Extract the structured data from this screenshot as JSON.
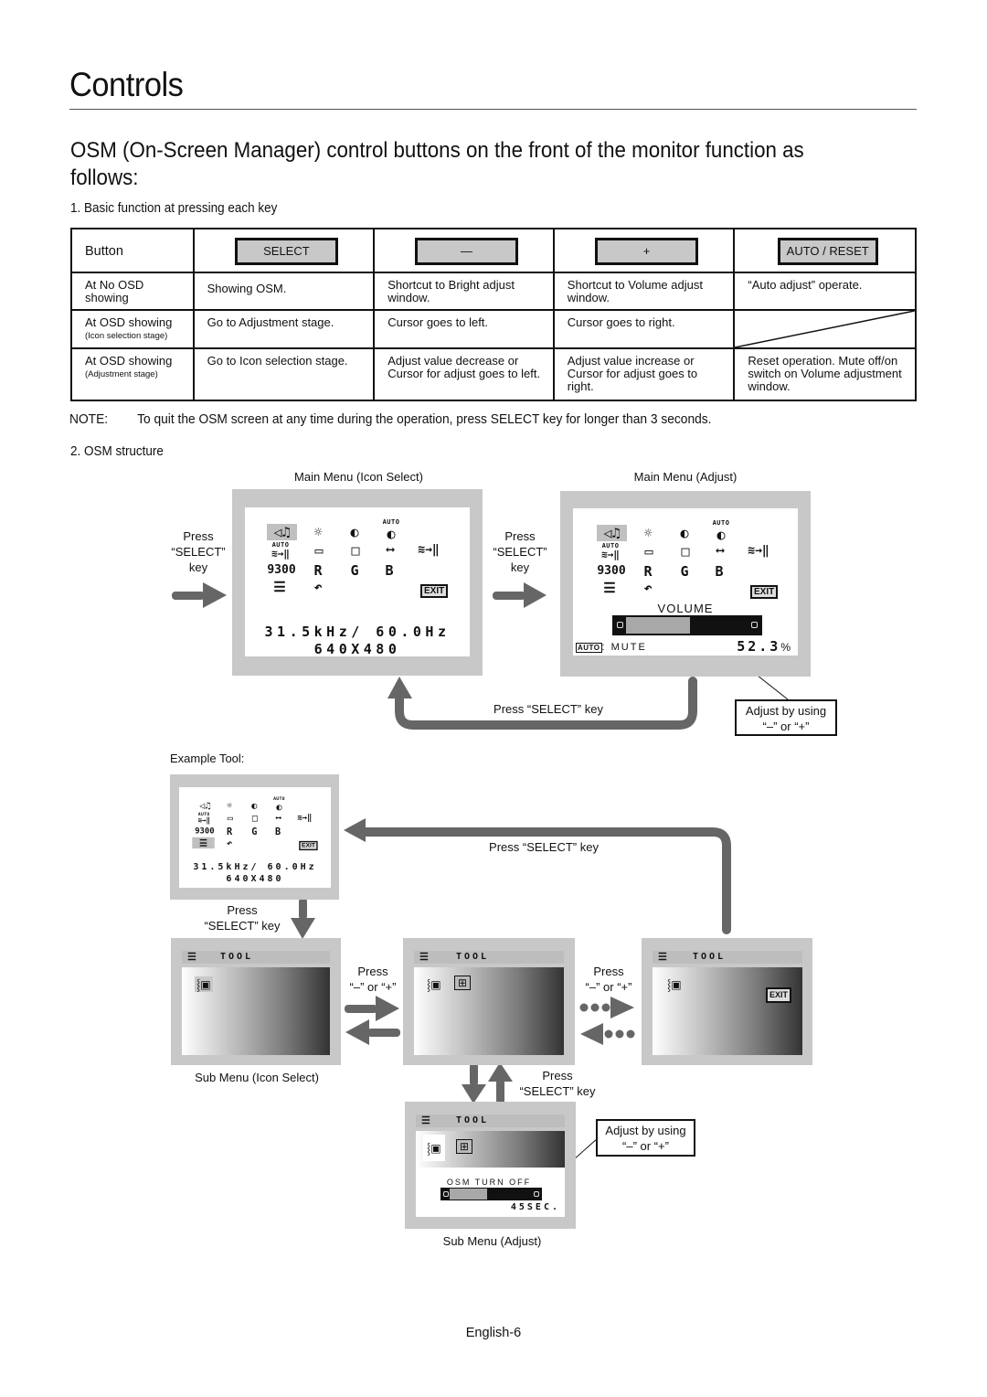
{
  "page": {
    "title": "Controls",
    "intro": "OSM (On-Screen Manager) control buttons on the front of the monitor function as follows:",
    "section1": "1. Basic function at pressing each key",
    "note_label": "NOTE:",
    "note_text": "To quit the OSM screen at any time during the operation, press SELECT key for longer than 3 seconds.",
    "section2": "2. OSM structure",
    "footer": "English-6"
  },
  "table": {
    "header_label": "Button",
    "keys": [
      "SELECT",
      "—",
      "+",
      "AUTO / RESET"
    ],
    "rows": [
      {
        "label": "At No OSD showing",
        "sublabel": "",
        "cells": [
          "Showing OSM.",
          "Shortcut to Bright adjust window.",
          "Shortcut to Volume adjust window.",
          "“Auto adjust” operate."
        ]
      },
      {
        "label": "At OSD showing",
        "sublabel": "(Icon selection stage)",
        "cells": [
          "Go to Adjustment stage.",
          "Cursor goes to left.",
          "Cursor goes to right.",
          ""
        ]
      },
      {
        "label": "At OSD showing",
        "sublabel": "(Adjustment stage)",
        "cells": [
          "Go to Icon selection stage.",
          "Adjust value decrease or Cursor for adjust goes to left.",
          "Adjust value increase or Cursor for adjust goes to right.",
          "Reset operation. Mute off/on switch on Volume adjustment window."
        ]
      }
    ]
  },
  "diagram": {
    "main_icon_select_caption": "Main Menu (Icon Select)",
    "main_adjust_caption": "Main Menu (Adjust)",
    "press_select_key_stacked": [
      "Press",
      "“SELECT”",
      "key"
    ],
    "press_select_key": "Press “SELECT” key",
    "press_select_two_line": [
      "Press",
      "“SELECT” key"
    ],
    "press_minus_plus": [
      "Press",
      "“–” or “+”"
    ],
    "adjust_by_using": [
      "Adjust by using",
      "“–” or “+”"
    ],
    "example_tool": "Example Tool:",
    "sub_icon_select_caption": "Sub Menu (Icon Select)",
    "sub_adjust_caption": "Sub Menu (Adjust)",
    "osm_icons": {
      "auto_tag": "AUTO",
      "row3": [
        "9300",
        "R",
        "G",
        "B"
      ],
      "exit": "EXIT"
    },
    "frequency": "31.5kHz/ 60.0Hz",
    "resolution": "640X480",
    "volume": {
      "label": "VOLUME",
      "auto_label": "AUTO",
      "mute_label": ": MUTE",
      "value": "52.3",
      "unit": "%",
      "fraction": 0.523
    },
    "tool": {
      "title": "TOOL",
      "exit": "EXIT",
      "osm_turn_off_label": "OSM TURN OFF",
      "osm_turn_off_value": "45SEC.",
      "osm_turn_off_fraction": 0.45
    }
  }
}
